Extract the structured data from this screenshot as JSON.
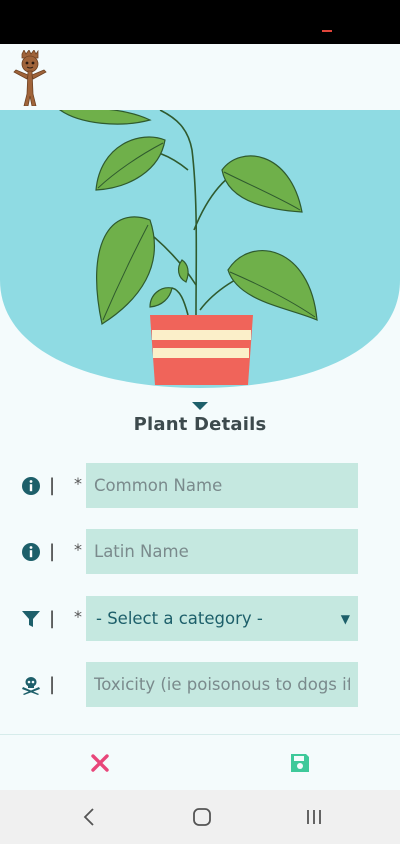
{
  "app": {
    "logo_icon": "groot-mascot-icon"
  },
  "hero": {
    "illustration": "potted-plant-illustration",
    "colors": {
      "background": "#8fdbe3",
      "leaf": "#6fb04a",
      "pot": "#f0645a",
      "stripe": "#fbefc9"
    }
  },
  "section": {
    "title": "Plant Details"
  },
  "form": {
    "common_name": {
      "placeholder": "Common Name",
      "required_mark": "*",
      "separator": "|",
      "icon": "info-icon"
    },
    "latin_name": {
      "placeholder": "Latin Name",
      "required_mark": "*",
      "separator": "|",
      "icon": "info-icon"
    },
    "category": {
      "selected": "- Select a category -",
      "required_mark": "*",
      "separator": "|",
      "icon": "filter-icon"
    },
    "toxicity": {
      "placeholder": "Toxicity (ie poisonous to dogs if",
      "separator": "|",
      "icon": "skull-crossbones-icon"
    }
  },
  "actions": {
    "cancel_icon": "close-icon",
    "save_icon": "save-icon",
    "colors": {
      "cancel": "#e8467a",
      "save": "#3ec99a"
    }
  },
  "system_nav": {
    "back_icon": "back-chevron-icon",
    "home_icon": "home-icon",
    "recents_icon": "recents-icon"
  }
}
